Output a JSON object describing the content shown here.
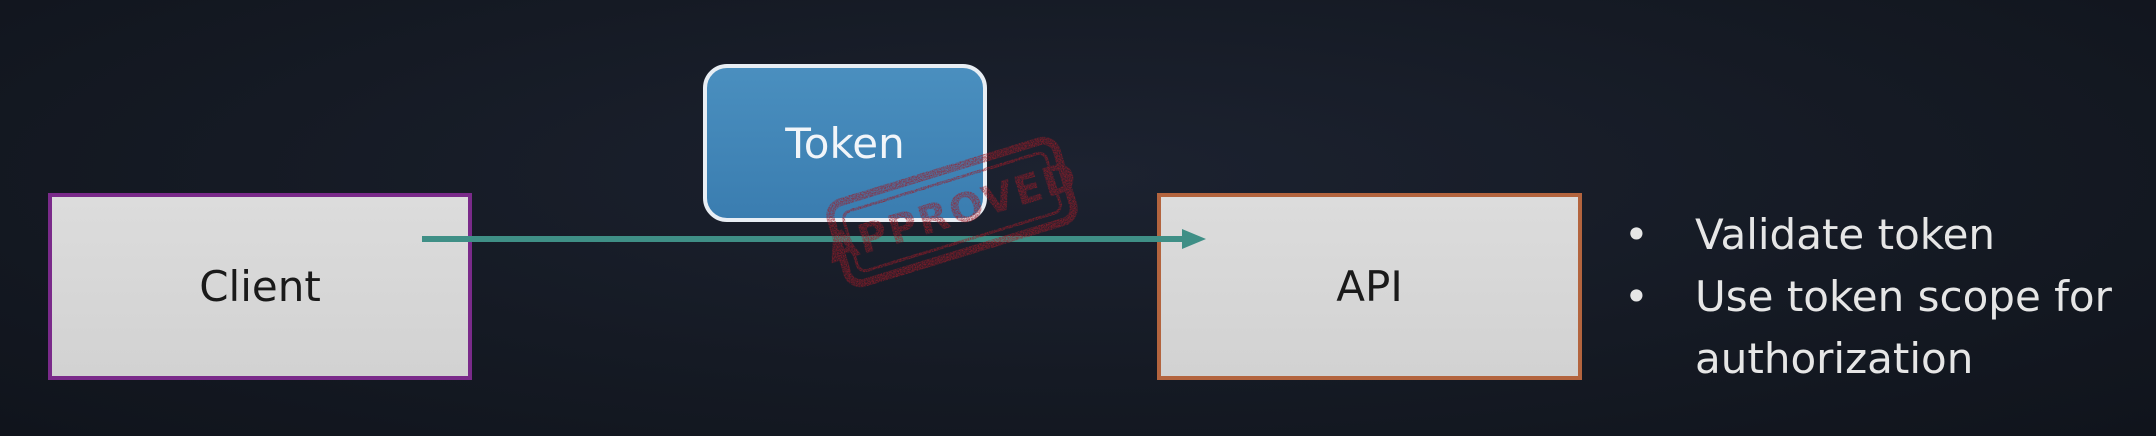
{
  "diagram": {
    "nodes": {
      "client": {
        "label": "Client"
      },
      "token": {
        "label": "Token"
      },
      "api": {
        "label": "API"
      }
    },
    "stamp": {
      "text": "APPROVED",
      "color": "#9c1c28"
    },
    "edges": [
      {
        "from": "client",
        "to": "api",
        "color": "#3f8f86"
      }
    ]
  },
  "bullets": {
    "marker": "•",
    "items": [
      "Validate token",
      "Use token scope for authorization"
    ]
  },
  "colors": {
    "client_border": "#7a2a8a",
    "api_border": "#b3643e",
    "token_fill": "#3a7db0",
    "arrow": "#3f8f86"
  }
}
